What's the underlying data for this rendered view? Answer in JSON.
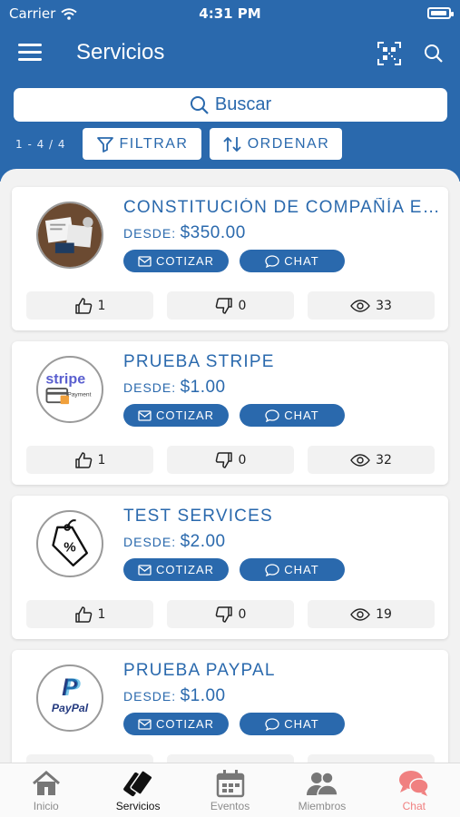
{
  "status": {
    "carrier": "Carrier",
    "time": "4:31 PM"
  },
  "header": {
    "title": "Servicios",
    "menu_icon": "hamburger-icon",
    "qr_icon": "qr-code-icon",
    "search_icon": "search-icon"
  },
  "search": {
    "placeholder": "Buscar"
  },
  "list_meta": {
    "count": "1 - 4 / 4"
  },
  "toolbar": {
    "filter_label": "FILTRAR",
    "sort_label": "ORDENAR"
  },
  "services": [
    {
      "title": "CONSTITUCIÓN DE COMPAÑÍA E…",
      "price_label": "DESDE:",
      "price": "$350.00",
      "quote_label": "COTIZAR",
      "chat_label": "CHAT",
      "likes": "1",
      "dislikes": "0",
      "views": "33",
      "image": "documents-desk-photo"
    },
    {
      "title": "PRUEBA STRIPE",
      "price_label": "DESDE:",
      "price": "$1.00",
      "quote_label": "COTIZAR",
      "chat_label": "CHAT",
      "likes": "1",
      "dislikes": "0",
      "views": "32",
      "image": "stripe-payment-logo",
      "logo_text": "stripe",
      "logo_sub": "Payment"
    },
    {
      "title": "TEST SERVICES",
      "price_label": "DESDE:",
      "price": "$2.00",
      "quote_label": "COTIZAR",
      "chat_label": "CHAT",
      "likes": "1",
      "dislikes": "0",
      "views": "19",
      "image": "discount-tag-icon"
    },
    {
      "title": "PRUEBA PAYPAL",
      "price_label": "DESDE:",
      "price": "$1.00",
      "quote_label": "COTIZAR",
      "chat_label": "CHAT",
      "likes": "",
      "dislikes": "",
      "views": "",
      "image": "paypal-logo",
      "logo_text": "PayPal"
    }
  ],
  "tabs": [
    {
      "label": "Inicio",
      "icon": "home-icon"
    },
    {
      "label": "Servicios",
      "icon": "tickets-icon"
    },
    {
      "label": "Eventos",
      "icon": "calendar-icon"
    },
    {
      "label": "Miembros",
      "icon": "members-icon"
    },
    {
      "label": "Chat",
      "icon": "chat-bubbles-icon"
    }
  ],
  "colors": {
    "primary": "#2a69ad",
    "chat_accent": "#f08080",
    "background": "#f2f2f2"
  }
}
